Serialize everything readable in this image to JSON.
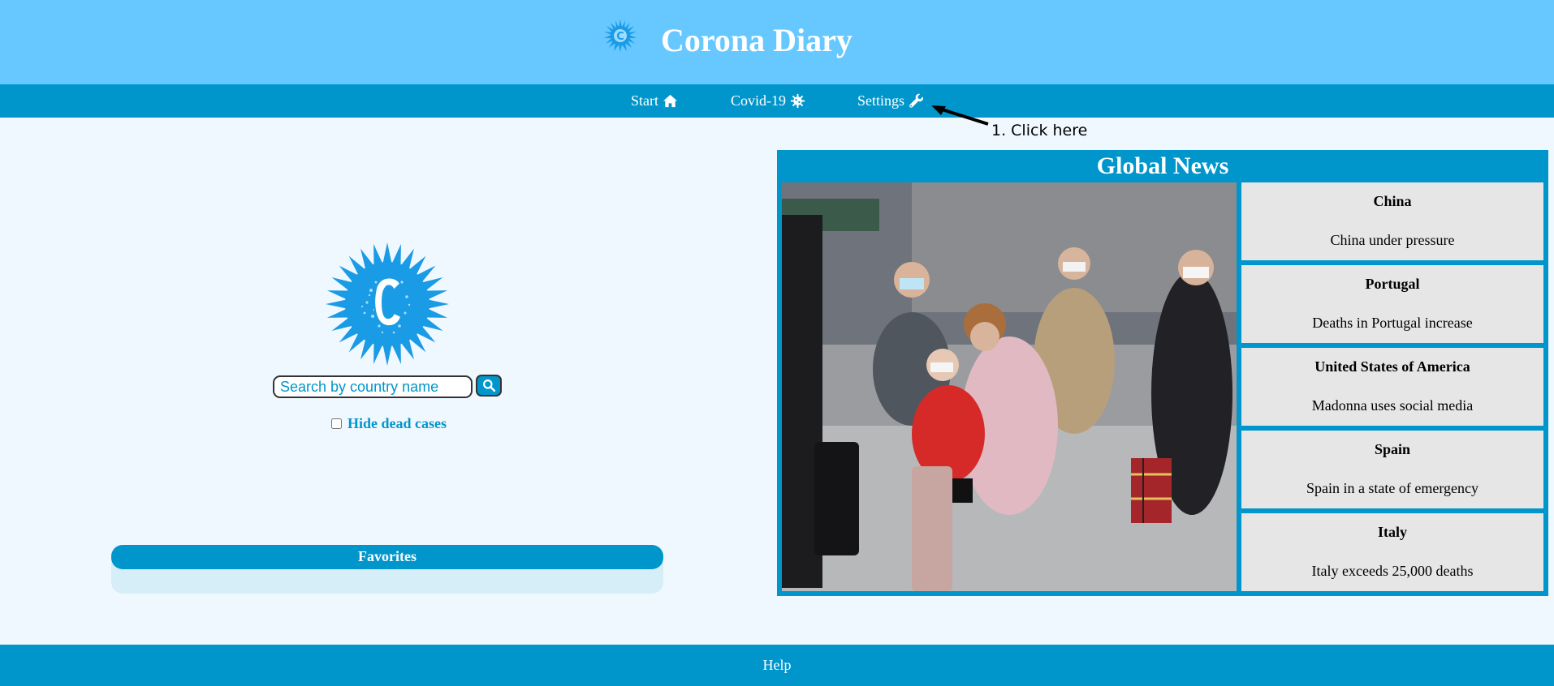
{
  "header": {
    "title": "Corona Diary",
    "logo_icon": "virus-logo-icon"
  },
  "nav": {
    "items": [
      {
        "label": "Start",
        "icon": "home-icon"
      },
      {
        "label": "Covid-19",
        "icon": "virus-icon"
      },
      {
        "label": "Settings",
        "icon": "wrench-icon"
      }
    ]
  },
  "annotation": {
    "text": "1. Click here"
  },
  "search": {
    "placeholder": "Search by country name",
    "button_icon": "search-icon"
  },
  "filter": {
    "hide_dead_label": "Hide dead cases",
    "checked": false
  },
  "favorites": {
    "title": "Favorites"
  },
  "news": {
    "title": "Global News",
    "items": [
      {
        "country": "China",
        "headline": "China under pressure"
      },
      {
        "country": "Portugal",
        "headline": "Deaths in Portugal increase"
      },
      {
        "country": "United States of America",
        "headline": "Madonna uses social media"
      },
      {
        "country": "Spain",
        "headline": "Spain in a state of emergency"
      },
      {
        "country": "Italy",
        "headline": "Italy exceeds 25,000 deaths"
      }
    ]
  },
  "footer": {
    "help_label": "Help"
  },
  "colors": {
    "header_bg": "#66c8ff",
    "nav_bg": "#0096cc",
    "page_bg": "#f0f8ff",
    "card_bg": "#e6e6e6",
    "accent": "#0096cc"
  }
}
